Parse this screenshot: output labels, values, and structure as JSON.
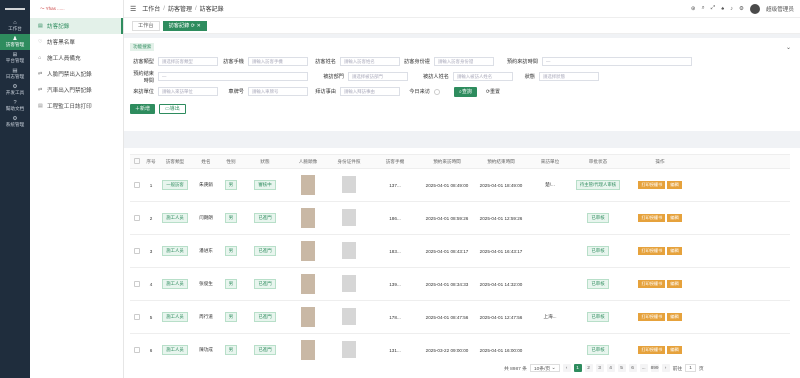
{
  "rail": [
    {
      "icon": "⌂",
      "label": "工作台"
    },
    {
      "icon": "♟",
      "label": "訪客管理"
    },
    {
      "icon": "⊞",
      "label": "平台管理"
    },
    {
      "icon": "▤",
      "label": "日志管理"
    },
    {
      "icon": "⚙",
      "label": "开发工具"
    },
    {
      "icon": "?",
      "label": "幫助文档"
    },
    {
      "icon": "⚙",
      "label": "系统管理"
    }
  ],
  "brand": "～ Yhas ......",
  "submenu": [
    {
      "icon": "▤",
      "label": "訪客記錄"
    },
    {
      "icon": "♡",
      "label": "訪客黑名單"
    },
    {
      "icon": "⌂",
      "label": "施工人員備充"
    },
    {
      "icon": "⇄",
      "label": "人臉門禁出入記錄"
    },
    {
      "icon": "⇄",
      "label": "汽車出入門禁記錄"
    },
    {
      "icon": "▤",
      "label": "工程監工日誌打印"
    }
  ],
  "header": {
    "crumbs": [
      "工作台",
      "訪客管理",
      "訪客記錄"
    ],
    "user": "超级管理员"
  },
  "tabs": [
    "工作台",
    "訪客記錄"
  ],
  "filter": {
    "title": "功能搜索",
    "r1": [
      {
        "label": "訪客類型",
        "ph": "請选择訪客類型"
      },
      {
        "label": "訪客手機",
        "ph": "請輸入訪客手機"
      },
      {
        "label": "訪客姓名",
        "ph": "請輸入訪客姓名"
      },
      {
        "label": "訪客身份證",
        "ph": "請輸入訪客身份證"
      },
      {
        "label": "預約來訪時間",
        "ph": "—"
      }
    ],
    "r2": [
      {
        "label": "預約結束時間",
        "ph": "—"
      },
      {
        "label": "被訪部門",
        "ph": "請选择被訪部門"
      },
      {
        "label": "被訪人姓名",
        "ph": "請輸入被訪人姓名"
      },
      {
        "label": "狀態",
        "ph": "請选择狀態"
      }
    ],
    "r3": [
      {
        "label": "來訪單位",
        "ph": "請輸入來訪單位"
      },
      {
        "label": "車牌号",
        "ph": "請輸入車牌号"
      },
      {
        "label": "拜访事由",
        "ph": "請輸入拜訪事由"
      },
      {
        "label": "今日来访",
        "ph": ""
      }
    ],
    "search": "查詢",
    "reset": "重置",
    "add": "新增",
    "export": "導出"
  },
  "table": {
    "headers": [
      "序号",
      "訪客類型",
      "姓名",
      "性别",
      "狀態",
      "人臉頭像",
      "身份证件照",
      "訪客手機",
      "預約來訪時間",
      "預約結束時間",
      "來訪單位",
      "审批状态",
      "操作"
    ],
    "rows": [
      {
        "n": "1",
        "type": "一般訪客",
        "name": "朱庚銷",
        "sex": "男",
        "status": "審核中",
        "phone": "137...",
        "start": "2025-04-01 08:49:00",
        "end": "2025-04-01 18:49:00",
        "unit": "楚/...",
        "approve": "待主管/代理人审核"
      },
      {
        "n": "2",
        "type": "施工人员",
        "name": "闫朗朗",
        "sex": "男",
        "status": "已進門",
        "phone": "186...",
        "start": "2025-04-01 08:59:26",
        "end": "2025-04-01 12:59:26",
        "unit": "",
        "approve": "已审核"
      },
      {
        "n": "3",
        "type": "施工人员",
        "name": "潘进东",
        "sex": "男",
        "status": "已進門",
        "phone": "183...",
        "start": "2025-04-01 08:43:17",
        "end": "2025-04-01 16:43:17",
        "unit": "",
        "approve": "已审核"
      },
      {
        "n": "4",
        "type": "施工人员",
        "name": "张俊生",
        "sex": "男",
        "status": "已進門",
        "phone": "139...",
        "start": "2025-04-01 08:34:33",
        "end": "2025-04-01 14:32:00",
        "unit": "",
        "approve": "已审核"
      },
      {
        "n": "5",
        "type": "施工人员",
        "name": "周行道",
        "sex": "男",
        "status": "已進門",
        "phone": "178...",
        "start": "2025-04-01 08:47:56",
        "end": "2025-04-01 12:47:56",
        "unit": "上海...",
        "approve": "已审核"
      },
      {
        "n": "6",
        "type": "施工人员",
        "name": "陳功成",
        "sex": "男",
        "status": "已進門",
        "phone": "131...",
        "start": "2025-03-22 09:00:00",
        "end": "2025-04-01 16:00:00",
        "unit": "",
        "approve": "已审核"
      }
    ],
    "op_print": "打印授權书",
    "op_edit": "編輯"
  },
  "pager": {
    "total": "共 8987 条",
    "size": "10条/页",
    "pages": [
      "1",
      "2",
      "3",
      "4",
      "5",
      "6",
      "...",
      "899"
    ],
    "goto": "前往",
    "goto_val": "1",
    "unit": "页"
  }
}
